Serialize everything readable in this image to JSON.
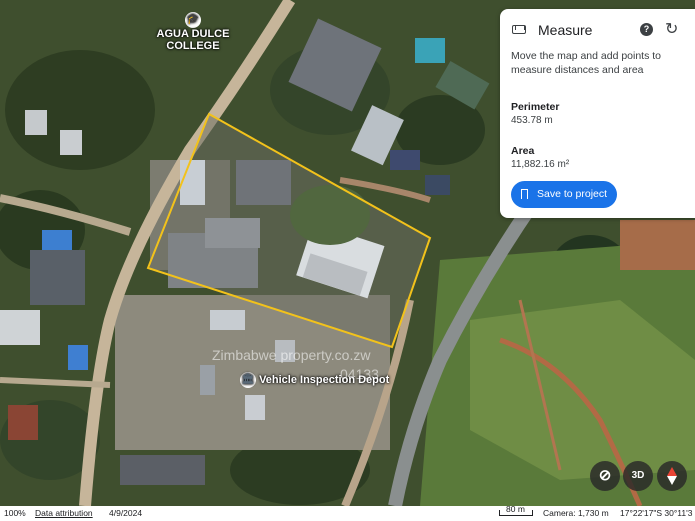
{
  "map": {
    "place_labels": {
      "college": "AGUA DULCE\nCOLLEGE",
      "depot": "Vehicle Inspection Depot"
    },
    "watermark": {
      "line1": "Zimbabwe   property.co.zw",
      "line2": "04133"
    },
    "outline_color": "#f2c21b"
  },
  "measure_panel": {
    "title": "Measure",
    "instructions": "Move the map and add points to measure distances and area",
    "perimeter_label": "Perimeter",
    "perimeter_value": "453.78 m",
    "area_label": "Area",
    "area_value": "11,882.16 m²",
    "save_label": "Save to project",
    "accent_color": "#1a73e8"
  },
  "controls": {
    "three_d_label": "3D"
  },
  "status_bar": {
    "zoom": "100%",
    "data_attribution": "Data attribution",
    "date": "4/9/2024",
    "scale": "80 m",
    "camera": "Camera: 1,730 m",
    "coordinates": "17°22'17\"S 30°11'3"
  }
}
